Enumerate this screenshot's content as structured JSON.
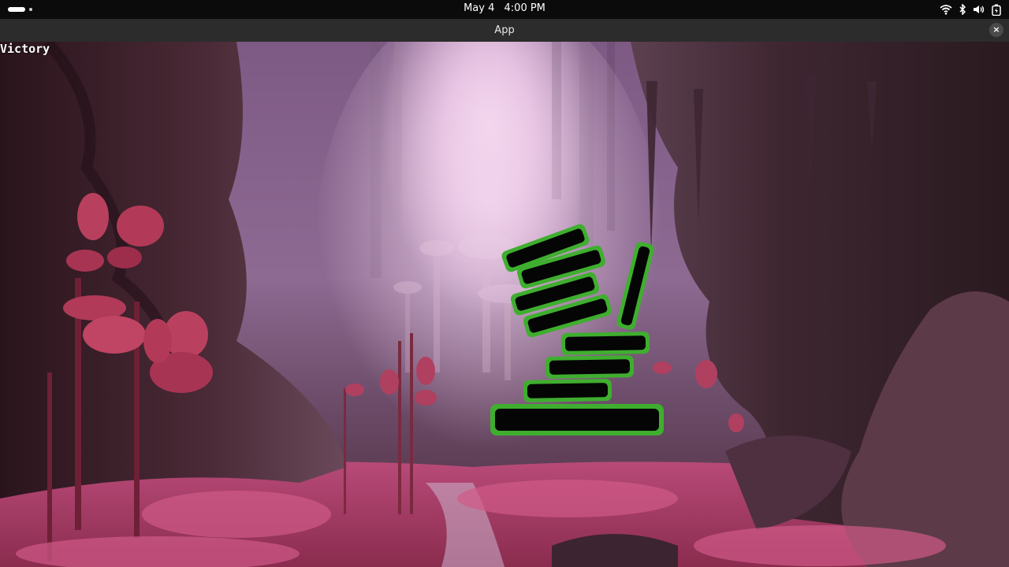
{
  "system_bar": {
    "date": "May 4",
    "time": "4:00 PM",
    "icons": [
      "wifi-icon",
      "bluetooth-icon",
      "volume-icon",
      "battery-icon"
    ]
  },
  "window": {
    "title": "App",
    "close_label": "×"
  },
  "game": {
    "status_text": "Victory",
    "background": "pink alien cavern with fungal forest",
    "tower_blocks": 9,
    "block_style": "black slab with green grass edges"
  },
  "colors": {
    "grass": "#3fae2f",
    "block": "#050505",
    "fog": "#e8c6e6",
    "ground": "#c94c7a"
  }
}
